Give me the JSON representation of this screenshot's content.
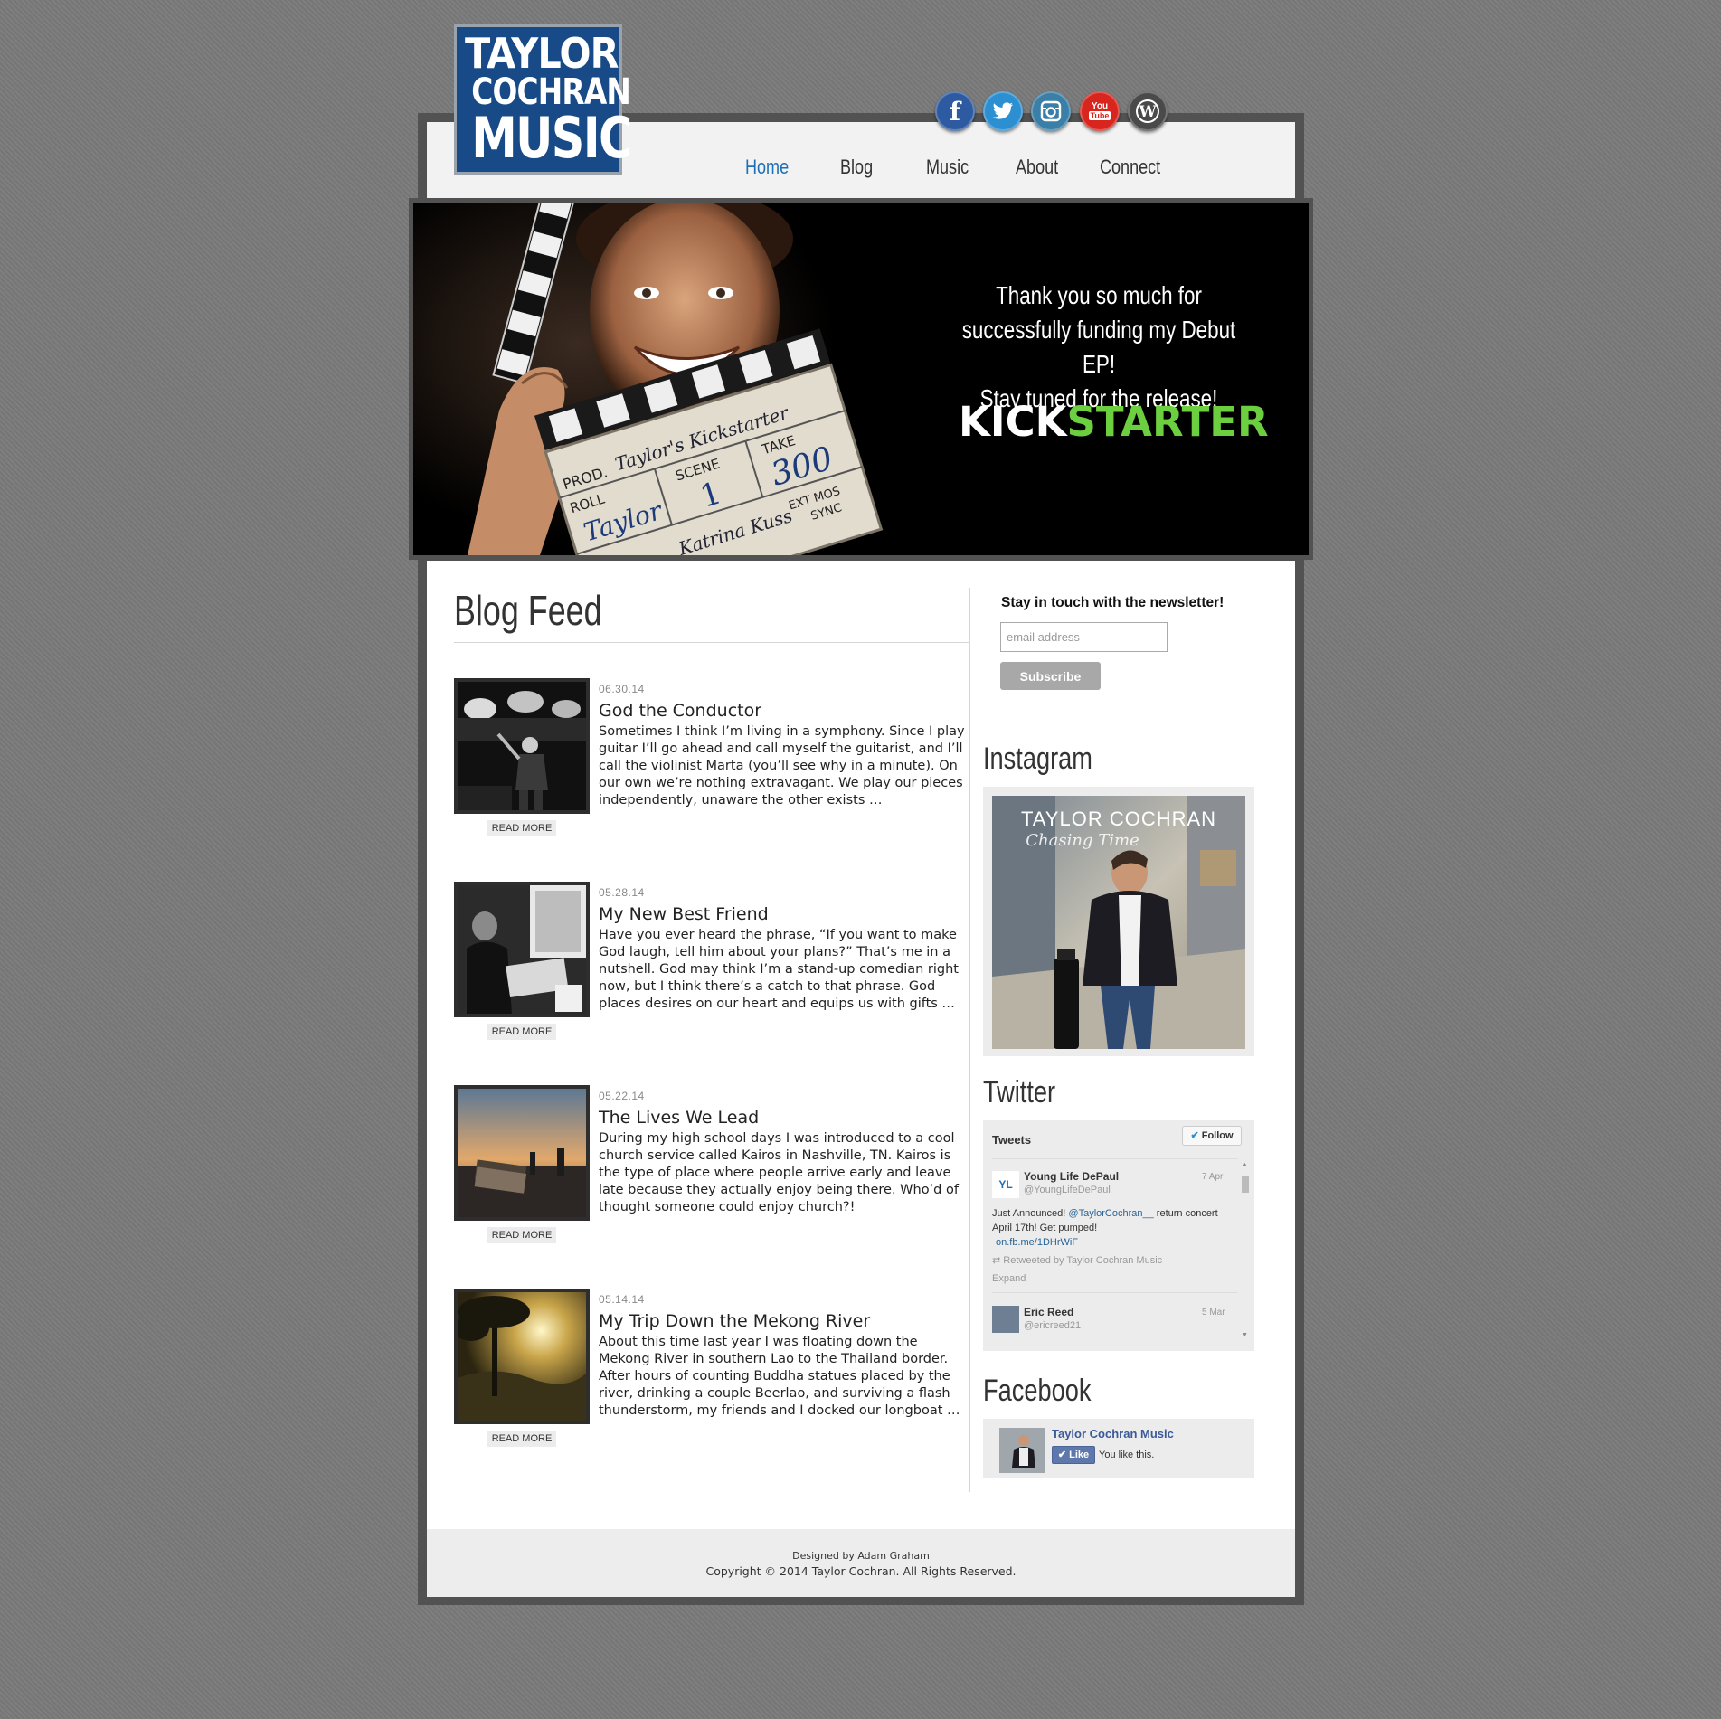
{
  "logo": {
    "line1": "TAYLOR",
    "line2": "COCHRAN",
    "line3": "MUSIC"
  },
  "social": [
    {
      "name": "facebook",
      "glyph": "f",
      "color": "#2d5aa0"
    },
    {
      "name": "twitter",
      "glyph": "t",
      "color": "#2b8fd1"
    },
    {
      "name": "instagram",
      "glyph": "◙",
      "color": "#3a7fa8"
    },
    {
      "name": "youtube",
      "glyph": "You",
      "color": "#d8261e"
    },
    {
      "name": "wordpress",
      "glyph": "W",
      "color": "#4a4a4a"
    }
  ],
  "nav": {
    "home": "Home",
    "blog": "Blog",
    "music": "Music",
    "about": "About",
    "connect": "Connect",
    "active_color": "#1f6fb5"
  },
  "hero": {
    "line1": "Thank you so much for",
    "line2": "successfully funding my Debut EP!",
    "line3": "Stay tuned for the release!",
    "kick_white": "KICK",
    "kick_green": "STARTER",
    "kick_green_color": "#6bcf3f",
    "slate": {
      "prod": "PROD.",
      "title": "Taylor's Kickstarter",
      "scene": "SCENE",
      "take": "TAKE",
      "take_num": "300",
      "scene_num": "1",
      "roll": "ROLL",
      "name": "Taylor",
      "ext": "EXT MOS",
      "sync": "SYNC",
      "signature": "Katrina Kuss"
    }
  },
  "blog": {
    "title": "Blog Feed",
    "read_more": "READ MORE",
    "posts": [
      {
        "date": "06.30.14",
        "title": "God the Conductor",
        "body": "Sometimes I think I’m living in a symphony. Since I play guitar I’ll go ahead and call myself the guitarist, and I’ll call the violinist Marta (you’ll see why in a minute). On our own we’re nothing extravagant. We play our pieces independently, unaware the other exists …"
      },
      {
        "date": "05.28.14",
        "title": "My New Best Friend",
        "body": "Have you ever heard the phrase, “If you want to make God laugh, tell him about your plans?” That’s me in a nutshell. God may think I’m a stand-up comedian right now, but I think there’s a catch to that phrase. God places desires on our heart and equips us with gifts …"
      },
      {
        "date": "05.22.14",
        "title": "The Lives We Lead",
        "body": "During my high school days I was introduced to a cool church service called Kairos in Nashville, TN. Kairos is the type of place where people arrive early and leave late because they actually enjoy being there. Who’d of thought someone could enjoy church?!"
      },
      {
        "date": "05.14.14",
        "title": "My Trip Down the Mekong River",
        "body": "About this time last year I was floating down the Mekong River in southern Lao to the Thailand border. After hours of counting Buddha statues placed by the river, drinking a couple Beerlao, and surviving a flash thunderstorm, my friends and I docked our longboat …"
      }
    ]
  },
  "sidebar": {
    "newsletter_label": "Stay in touch with the newsletter!",
    "email_placeholder": "email address",
    "subscribe": "Subscribe",
    "instagram_title": "Instagram",
    "insta_artist": "TAYLOR COCHRAN",
    "insta_album": "Chasing Time",
    "twitter_title": "Twitter",
    "facebook_title": "Facebook"
  },
  "twitter": {
    "header": "Tweets",
    "follow": "Follow",
    "tweet1": {
      "name": "Young Life DePaul",
      "handle": "@YoungLifeDePaul",
      "date": "7 Apr",
      "text_before": "Just Announced! ",
      "mention": "@TaylorCochran__",
      "text_after": " return concert April 17th! Get pumped!",
      "link": "on.fb.me/1DHrWiF",
      "retweet": "Retweeted by Taylor Cochran Music",
      "expand": "Expand",
      "avatar_text": "YL"
    },
    "tweet2": {
      "name": "Eric Reed",
      "handle": "@ericreed21",
      "date": "5 Mar"
    }
  },
  "facebook": {
    "page": "Taylor Cochran Music",
    "like": "Like",
    "you_like": "You like this."
  },
  "footer": {
    "designed": "Designed by Adam Graham",
    "copyright": "Copyright © 2014 Taylor Cochran. All Rights Reserved."
  }
}
